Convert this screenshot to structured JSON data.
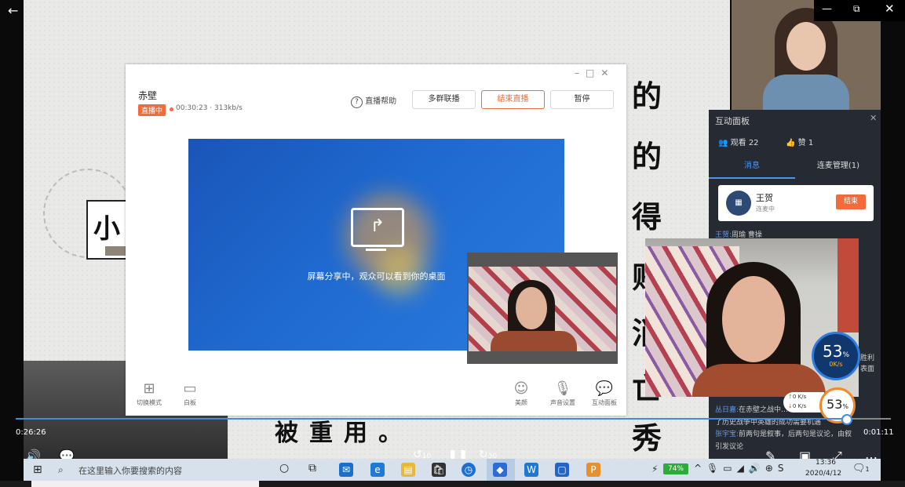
{
  "player": {
    "time_current": "0:26:26",
    "time_remaining": "0:01:11",
    "skip_back": "10",
    "skip_forward": "30",
    "progress": 0.946
  },
  "dialog": {
    "title": "赤壁",
    "live_badge": "直播中",
    "stats": "00:30:23 · 313kb/s",
    "help_label": "直播帮助",
    "multi_label": "多群联播",
    "end_label": "结束直播",
    "pause_label": "暂停",
    "share_text": "屏幕分享中，观众可以看到你的桌面",
    "tools_left": [
      {
        "icon": "grid-icon",
        "label": "切换模式"
      },
      {
        "icon": "whiteboard-icon",
        "label": "白板"
      }
    ],
    "tools_right": [
      {
        "icon": "smile-icon",
        "label": "美颜"
      },
      {
        "icon": "mic-icon",
        "label": "声音设置"
      },
      {
        "icon": "chat-icon",
        "label": "互动面板"
      }
    ]
  },
  "panel": {
    "title": "互动面板",
    "viewers": "观看 22",
    "likes": "赞 1",
    "tab_messages": "消息",
    "tab_mic": "连麦管理(1)",
    "host_name": "王贺",
    "host_status": "连麦中",
    "host_end": "结束",
    "messages": [
      {
        "name": "王贺:",
        "text": "周瑜 曹操"
      },
      {
        "name": "丛日嘉:",
        "text": "在赤壁之战中…说明"
      },
      {
        "name": "",
        "text": "了历史战争中英雄的成功需要机遇"
      },
      {
        "name": "张宇宝:",
        "text": "前两句是叙事，后两句是议论，由叙"
      },
      {
        "name": "",
        "text": "引发议论"
      }
    ],
    "side_text": "胜利\n表面"
  },
  "slide": {
    "callig_column": [
      "的",
      "的",
      "得",
      "贱",
      "消",
      "亡",
      "秀"
    ],
    "bottom_text": "被重用。",
    "left_char": "小"
  },
  "gauge": {
    "percent": "53",
    "unit": "%",
    "speed": "0K/s"
  },
  "gauge2": {
    "percent": "53",
    "unit": "%",
    "up": "0 K/s",
    "down": "0 K/s"
  },
  "taskbar": {
    "search_placeholder": "在这里输入你要搜索的内容",
    "battery": "74%",
    "time": "13:36",
    "date": "2020/4/12",
    "notify_count": "1"
  },
  "colors": {
    "accent": "#f26b3a",
    "blue": "#3a8ee6",
    "panel": "#262b33"
  }
}
